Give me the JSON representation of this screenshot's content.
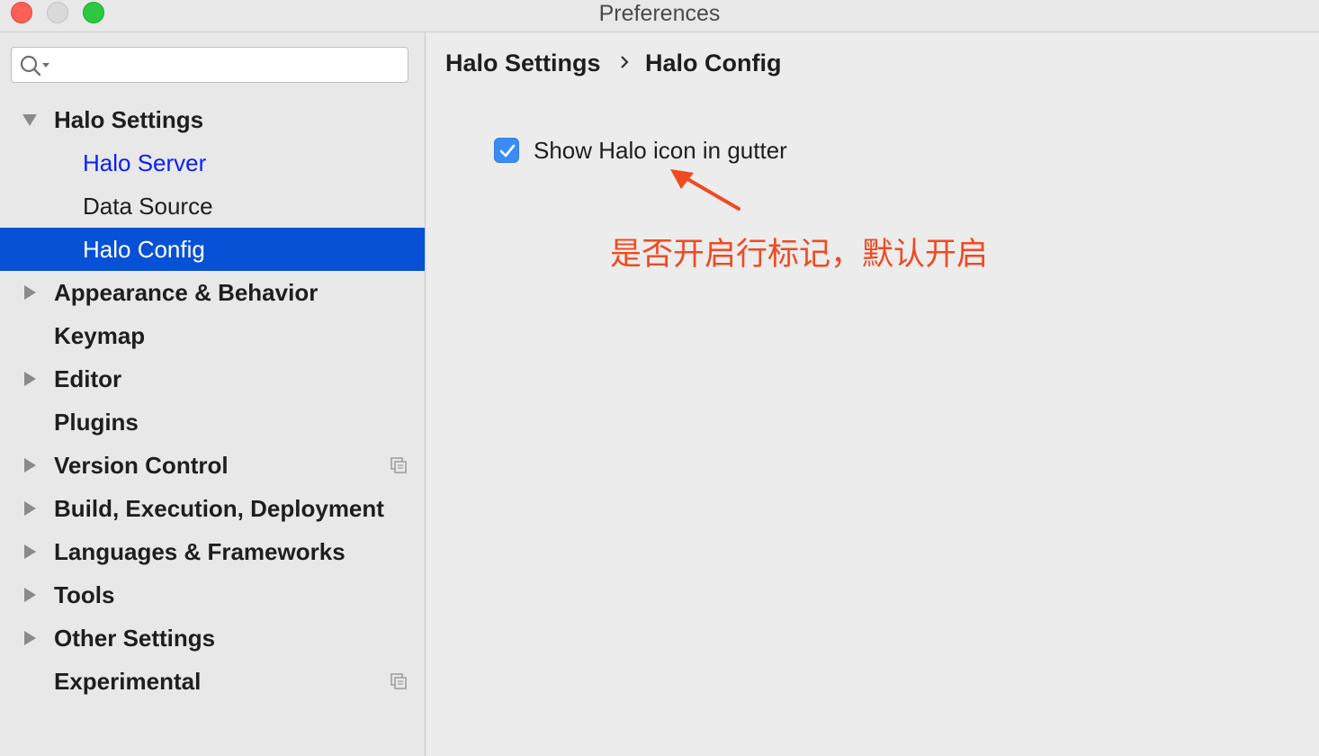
{
  "window": {
    "title": "Preferences"
  },
  "search": {
    "placeholder": "",
    "value": ""
  },
  "sidebar": {
    "items": [
      {
        "label": "Halo Settings",
        "expanded": true
      },
      {
        "label": "Halo Server"
      },
      {
        "label": "Data Source"
      },
      {
        "label": "Halo Config",
        "selected": true
      },
      {
        "label": "Appearance & Behavior"
      },
      {
        "label": "Keymap"
      },
      {
        "label": "Editor"
      },
      {
        "label": "Plugins"
      },
      {
        "label": "Version Control"
      },
      {
        "label": "Build, Execution, Deployment"
      },
      {
        "label": "Languages & Frameworks"
      },
      {
        "label": "Tools"
      },
      {
        "label": "Other Settings"
      },
      {
        "label": "Experimental"
      }
    ]
  },
  "breadcrumb": {
    "parent": "Halo Settings",
    "current": "Halo Config"
  },
  "options": {
    "show_gutter_icon_label": "Show Halo icon in gutter",
    "show_gutter_icon_checked": true
  },
  "annotation": {
    "text": "是否开启行标记，默认开启",
    "color": "#ef4a22"
  },
  "colors": {
    "selection": "#0751d6",
    "link": "#0b1ff5",
    "checkbox": "#3b8bf5"
  }
}
